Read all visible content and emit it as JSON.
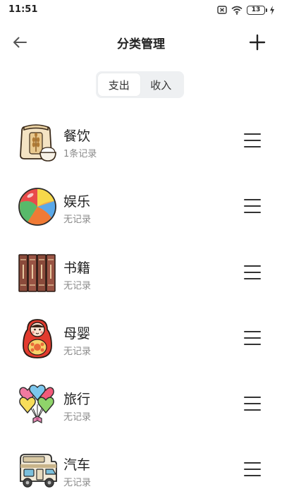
{
  "status_bar": {
    "time": "11:51",
    "battery_level": "13",
    "icons": [
      "sim-icon",
      "wifi-icon",
      "battery-icon",
      "charging-icon"
    ]
  },
  "nav": {
    "title": "分类管理",
    "back_icon": "arrow-left-icon",
    "add_icon": "plus-icon"
  },
  "tabs": [
    {
      "label": "支出",
      "active": true
    },
    {
      "label": "收入",
      "active": false
    }
  ],
  "categories": [
    {
      "name": "餐饮",
      "subtitle": "1条记录",
      "icon": "rice-sack-icon"
    },
    {
      "name": "娱乐",
      "subtitle": "无记录",
      "icon": "beach-ball-icon"
    },
    {
      "name": "书籍",
      "subtitle": "无记录",
      "icon": "books-icon"
    },
    {
      "name": "母婴",
      "subtitle": "无记录",
      "icon": "matryoshka-doll-icon"
    },
    {
      "name": "旅行",
      "subtitle": "无记录",
      "icon": "heart-balloons-icon"
    },
    {
      "name": "汽车",
      "subtitle": "无记录",
      "icon": "camper-van-icon"
    }
  ],
  "colors": {
    "text": "#222222",
    "subtext": "#8a8a8a",
    "segment_bg": "#eef0f2",
    "active_tab_bg": "#ffffff"
  }
}
